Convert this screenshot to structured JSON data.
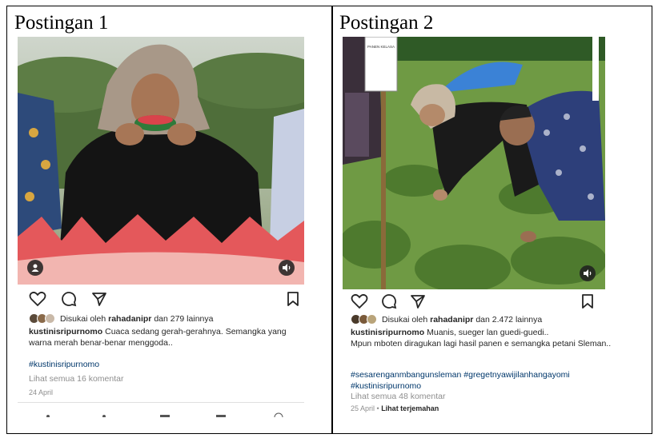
{
  "post1": {
    "title": "Postingan 1",
    "likes_prefix": "Disukai oleh",
    "likes_user": "rahadanipr",
    "likes_suffix": "dan 279 lainnya",
    "username": "kustinisripurnomo",
    "caption": "Cuaca sedang gerah-gerahnya. Semangka yang warna merah benar-benar menggoda..",
    "hashtags": "#kustinisripurnomo",
    "comments_link": "Lihat semua 16 komentar",
    "date": "24 April",
    "icons": [
      "heart-icon",
      "comment-icon",
      "share-icon",
      "bookmark-icon",
      "user-tag-icon",
      "volume-icon"
    ]
  },
  "post2": {
    "title": "Postingan 2",
    "likes_prefix": "Disukai oleh",
    "likes_user": "rahadanipr",
    "likes_suffix": "dan 2.472 lainnya",
    "username": "kustinisripurnomo",
    "caption_line1": "Muanis, sueger lan guedi-guedi..",
    "caption_line2": "Mpun mboten diragukan lagi hasil panen e semangka petani Sleman..",
    "hashtags": "#sesarenganmbangunsleman #gregetnyawijilanhangayomi #kustinisripurnomo",
    "comments_link": "Lihat semua 48 komentar",
    "date": "25 April",
    "translate_link": "Lihat terjemahan",
    "sign_text": "PANEN KELASA",
    "icons": [
      "heart-icon",
      "comment-icon",
      "share-icon",
      "bookmark-icon",
      "volume-icon"
    ]
  },
  "colors": {
    "link": "#00376b",
    "text": "#262626",
    "muted": "#8e8e8e"
  }
}
